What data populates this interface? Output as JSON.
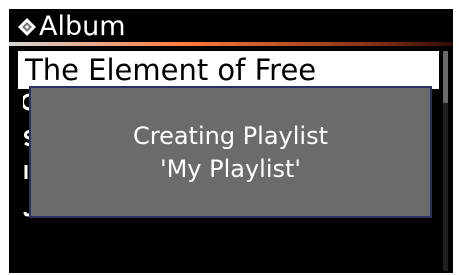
{
  "header": {
    "title": "Album",
    "icon": "album-diamond-icon"
  },
  "list": {
    "selected_item": "The Element of Free"
  },
  "dialog": {
    "line1": "Creating Playlist",
    "line2": "'My Playlist'"
  },
  "scrollbar": {
    "position_fraction": 0.0
  },
  "colors": {
    "background": "#000000",
    "dialog_bg": "#6b6b6b",
    "dialog_border": "#2c2f63",
    "accent_rule": "#ff7a3a",
    "selection_bg": "#ffffff"
  }
}
